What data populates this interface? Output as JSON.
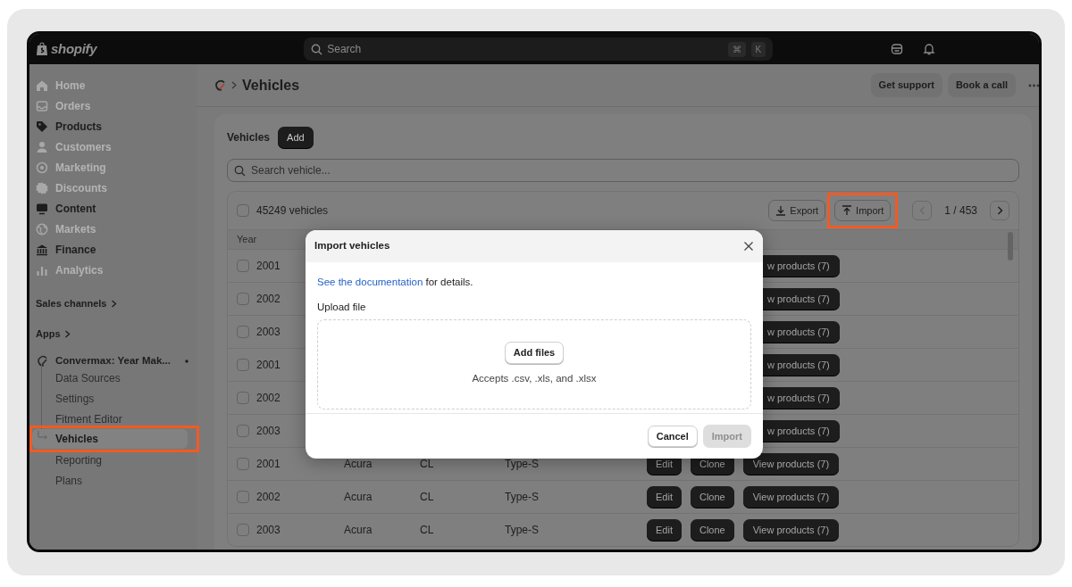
{
  "topbar": {
    "logo": "shopify",
    "search": {
      "placeholder": "Search"
    },
    "shortcut": [
      "⌘",
      "K"
    ]
  },
  "sidebar": {
    "nav": [
      {
        "label": "Home",
        "kind": "home",
        "disabled": true
      },
      {
        "label": "Orders",
        "kind": "orders",
        "disabled": true
      },
      {
        "label": "Products",
        "kind": "products",
        "disabled": false
      },
      {
        "label": "Customers",
        "kind": "customers",
        "disabled": true
      },
      {
        "label": "Marketing",
        "kind": "marketing",
        "disabled": true
      },
      {
        "label": "Discounts",
        "kind": "discounts",
        "disabled": true
      },
      {
        "label": "Content",
        "kind": "content",
        "disabled": false
      },
      {
        "label": "Markets",
        "kind": "markets",
        "disabled": true
      },
      {
        "label": "Finance",
        "kind": "finance",
        "disabled": false
      },
      {
        "label": "Analytics",
        "kind": "analytics",
        "disabled": true
      }
    ],
    "sections": [
      "Sales channels",
      "Apps"
    ],
    "app": {
      "name": "Convermax: Year Mak...",
      "items": [
        {
          "label": "Data Sources",
          "selected": false,
          "highlighted": false
        },
        {
          "label": "Settings",
          "selected": false,
          "highlighted": false
        },
        {
          "label": "Fitment Editor",
          "selected": false,
          "highlighted": false
        },
        {
          "label": "Vehicles",
          "selected": true,
          "highlighted": true
        },
        {
          "label": "Reporting",
          "selected": false,
          "highlighted": false
        },
        {
          "label": "Plans",
          "selected": false,
          "highlighted": false
        }
      ]
    }
  },
  "page": {
    "title": "Vehicles",
    "actions": [
      "Get support",
      "Book a call"
    ]
  },
  "card": {
    "title": "Vehicles",
    "add": "Add",
    "search": {
      "placeholder": "Search vehicle..."
    },
    "table": {
      "count": "45249 vehicles",
      "all_checked": false,
      "export": "Export",
      "import": {
        "label": "Import",
        "highlighted": true
      },
      "prev_disabled": true,
      "pager": "1 / 453",
      "columns": [
        "Year"
      ],
      "rows": [
        {
          "checked": false,
          "year": "2001",
          "view": "w products (7)"
        },
        {
          "checked": false,
          "year": "2002",
          "view": "w products (7)"
        },
        {
          "checked": false,
          "year": "2003",
          "view": "w products (7)"
        },
        {
          "checked": false,
          "year": "2001",
          "view": "w products (7)"
        },
        {
          "checked": false,
          "year": "2002",
          "view": "w products (7)"
        },
        {
          "checked": false,
          "year": "2003",
          "view": "w products (7)"
        },
        {
          "checked": false,
          "year": "2001",
          "column_2": "Acura",
          "column_3": "CL",
          "column_4": "Type-S",
          "edit": "Edit",
          "clone": "Clone",
          "view": "View products (7)"
        },
        {
          "checked": false,
          "year": "2002",
          "column_2": "Acura",
          "column_3": "CL",
          "column_4": "Type-S",
          "edit": "Edit",
          "clone": "Clone",
          "view": "View products (7)"
        },
        {
          "checked": false,
          "year": "2003",
          "column_2": "Acura",
          "column_3": "CL",
          "column_4": "Type-S",
          "edit": "Edit",
          "clone": "Clone",
          "view": "View products (7)"
        }
      ]
    }
  },
  "modal": {
    "title": "Import vehicles",
    "link": "See the documentation",
    "text": "for details.",
    "upload_label": "Upload file",
    "add_files": "Add files",
    "accepts": "Accepts .csv, .xls, and .xlsx",
    "cancel": "Cancel",
    "submit": {
      "label": "Import",
      "disabled": true
    }
  }
}
